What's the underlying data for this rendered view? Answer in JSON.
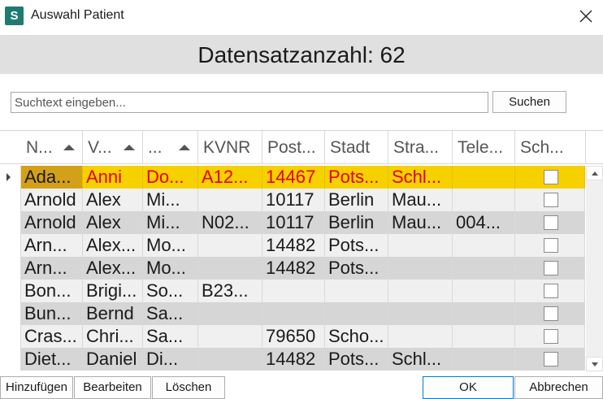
{
  "window": {
    "title": "Auswahl Patient",
    "app_icon_letter": "S"
  },
  "banner": {
    "text": "Datensatzanzahl: 62"
  },
  "search": {
    "placeholder": "Suchtext eingeben...",
    "value": "",
    "button_label": "Suchen"
  },
  "grid": {
    "columns": [
      {
        "label": "N...",
        "sorted": true
      },
      {
        "label": "V...",
        "sorted": true
      },
      {
        "label": "...",
        "sorted": true
      },
      {
        "label": "KVNR",
        "sorted": false
      },
      {
        "label": "Post...",
        "sorted": false
      },
      {
        "label": "Stadt",
        "sorted": false
      },
      {
        "label": "Stra...",
        "sorted": false
      },
      {
        "label": "Tele...",
        "sorted": false
      },
      {
        "label": "Sch...",
        "sorted": false
      }
    ],
    "rows": [
      {
        "cells": [
          "Ada...",
          "Anni",
          "Do...",
          "A12...",
          "14467",
          "Pots...",
          "Schl...",
          ""
        ],
        "checked": false,
        "selected": true
      },
      {
        "cells": [
          "Arnold",
          "Alex",
          "Mi...",
          "",
          "10117",
          "Berlin",
          "Mau...",
          ""
        ],
        "checked": false,
        "selected": false
      },
      {
        "cells": [
          "Arnold",
          "Alex",
          "Mi...",
          "N02...",
          "10117",
          "Berlin",
          "Mau...",
          "004..."
        ],
        "checked": false,
        "selected": false
      },
      {
        "cells": [
          "Arn...",
          "Alex...",
          "Mo...",
          "",
          "14482",
          "Pots...",
          "",
          ""
        ],
        "checked": false,
        "selected": false
      },
      {
        "cells": [
          "Arn...",
          "Alex...",
          "Mo...",
          "",
          "14482",
          "Pots...",
          "",
          ""
        ],
        "checked": false,
        "selected": false
      },
      {
        "cells": [
          "Bon...",
          "Brigi...",
          "So...",
          "B23...",
          "",
          "",
          "",
          ""
        ],
        "checked": false,
        "selected": false
      },
      {
        "cells": [
          "Bun...",
          "Bernd",
          "Sa...",
          "",
          "",
          "",
          "",
          ""
        ],
        "checked": false,
        "selected": false
      },
      {
        "cells": [
          "Cras...",
          "Chri...",
          "Sa...",
          "",
          "79650",
          "Scho...",
          "",
          ""
        ],
        "checked": false,
        "selected": false
      },
      {
        "cells": [
          "Diet...",
          "Daniel",
          "Di...",
          "",
          "14482",
          "Pots...",
          "Schl...",
          ""
        ],
        "checked": false,
        "selected": false
      }
    ]
  },
  "footer": {
    "add_label": "Hinzufügen",
    "edit_label": "Bearbeiten",
    "delete_label": "Löschen",
    "ok_label": "OK",
    "cancel_label": "Abbrechen"
  },
  "colors": {
    "selected_row": "#f7d000",
    "selected_text": "#e60000",
    "accent": "#1f7a70",
    "alt_row": "#d6d6d6"
  }
}
